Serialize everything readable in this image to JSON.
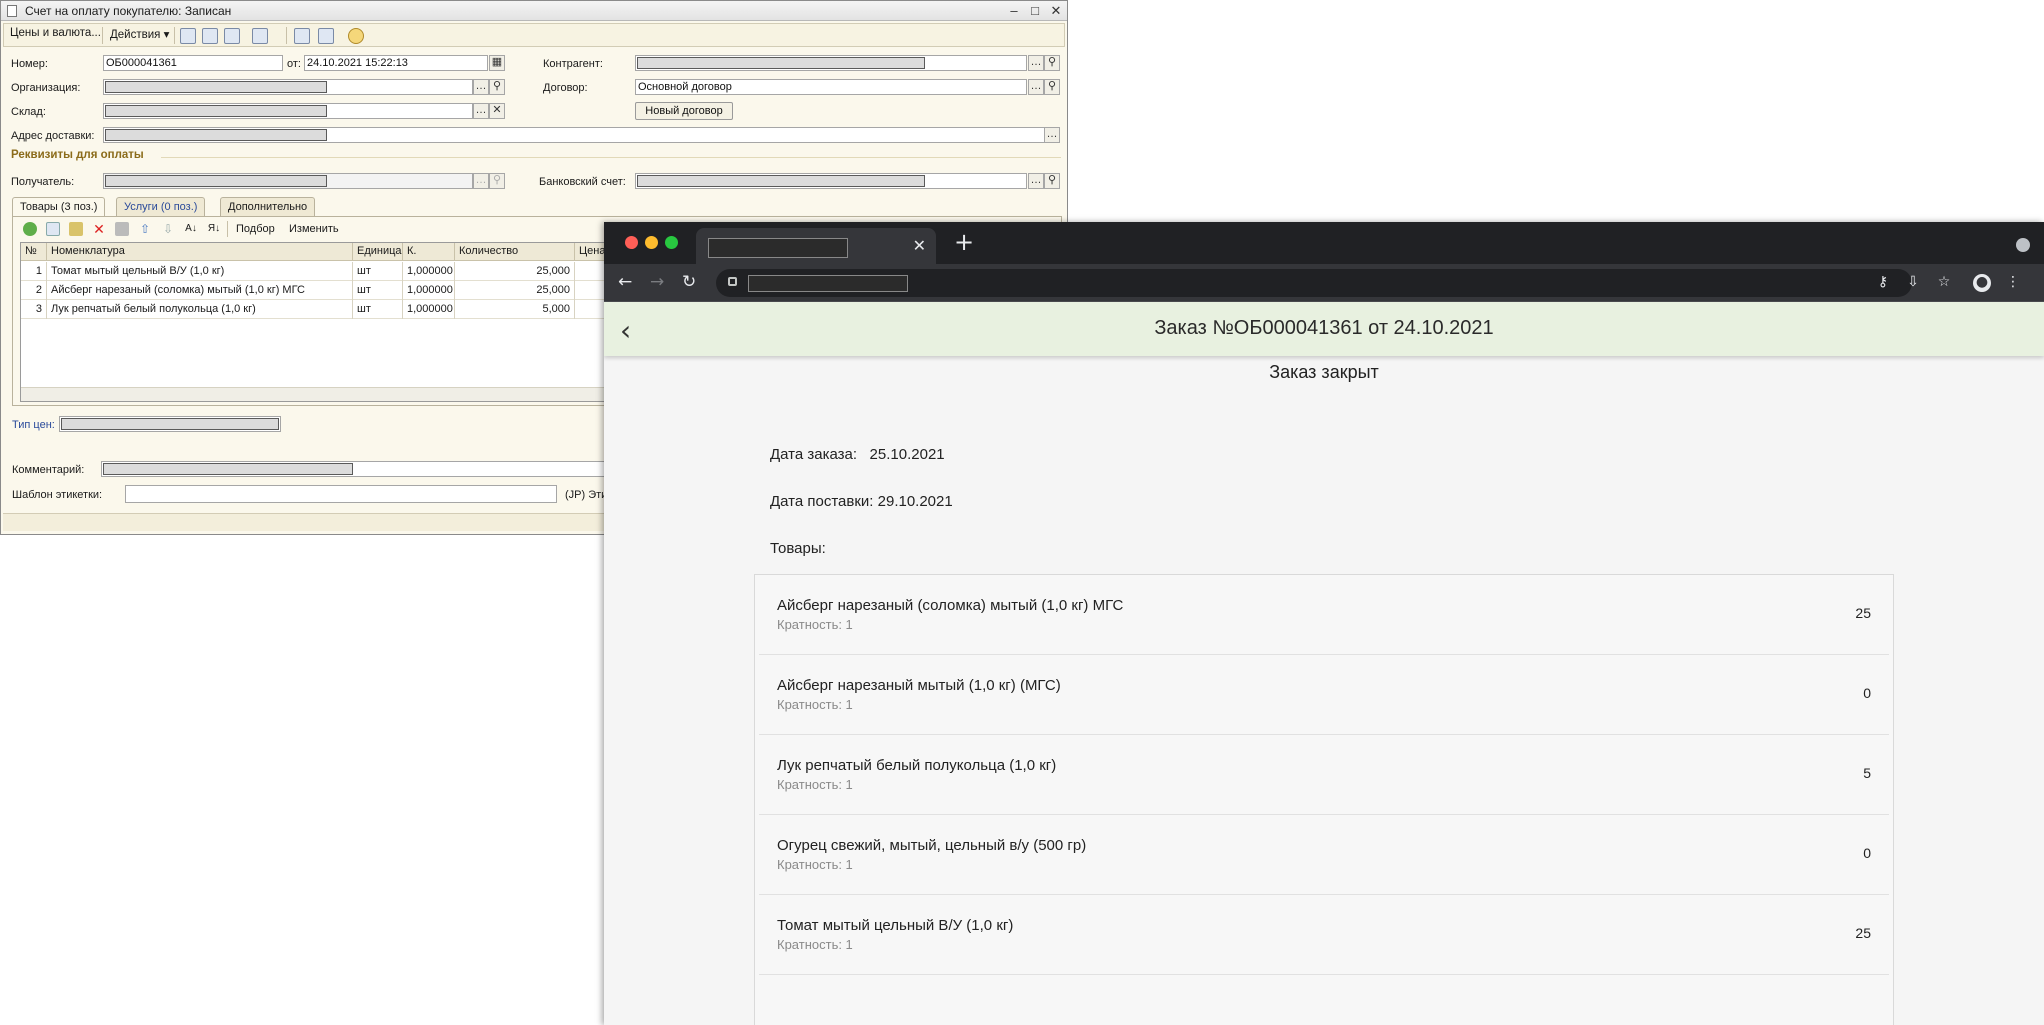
{
  "win1c": {
    "title": "Счет на оплату покупателю: Записан",
    "toolbar": {
      "prices": "Цены и валюта...",
      "actions": "Действия"
    },
    "fields": {
      "number_label": "Номер:",
      "number_value": "ОБ000041361",
      "date_label": "от:",
      "date_value": "24.10.2021 15:22:13",
      "org_label": "Организация:",
      "warehouse_label": "Склад:",
      "address_label": "Адрес доставки:",
      "counterparty_label": "Контрагент:",
      "contract_label": "Договор:",
      "contract_value": "Основной договор",
      "new_contract_btn": "Новый договор"
    },
    "payment": {
      "section": "Реквизиты для оплаты",
      "recipient_label": "Получатель:",
      "bank_label": "Банковский счет:"
    },
    "tabs": [
      "Товары (3 поз.)",
      "Услуги (0 поз.)",
      "Дополнительно"
    ],
    "grid_toolbar": {
      "pick": "Подбор",
      "change": "Изменить"
    },
    "grid": {
      "headers": [
        "№",
        "Номенклатура",
        "Единица",
        "К.",
        "Количество",
        "Цена"
      ],
      "rows": [
        [
          "1",
          "Томат мытый цельный В/У (1,0 кг)",
          "шт",
          "1,000000",
          "25,000"
        ],
        [
          "2",
          "Айсберг нарезаный (соломка) мытый (1,0 кг) МГС",
          "шт",
          "1,000000",
          "25,000"
        ],
        [
          "3",
          "Лук репчатый белый полукольца  (1,0 кг)",
          "шт",
          "1,000000",
          "5,000"
        ]
      ]
    },
    "bottom": {
      "price_type_label": "Тип цен:",
      "comment_label": "Комментарий:",
      "label_template": "Шаблон этикетки:",
      "jp_label": "(JP) Эти"
    }
  },
  "browser": {
    "app_title": "Заказ №ОБ000041361 от 24.10.2021",
    "status": "Заказ закрыт",
    "order_date": "Дата заказа:   25.10.2021",
    "delivery_date": "Дата поставки: 29.10.2021",
    "goods_label": "Товары:",
    "items": [
      {
        "name": "Айсберг нарезаный (соломка) мытый (1,0 кг) МГС",
        "sub": "Кратность: 1",
        "qty": "25"
      },
      {
        "name": "Айсберг нарезаный мытый (1,0 кг) (МГС)",
        "sub": "Кратность: 1",
        "qty": "0"
      },
      {
        "name": "Лук репчатый белый полукольца  (1,0 кг)",
        "sub": "Кратность: 1",
        "qty": "5"
      },
      {
        "name": "Огурец свежий, мытый, цельный в/у (500 гр)",
        "sub": "Кратность: 1",
        "qty": "0"
      },
      {
        "name": "Томат мытый цельный В/У (1,0 кг)",
        "sub": "Кратность: 1",
        "qty": "25"
      }
    ]
  },
  "icons": {
    "close": "close-icon",
    "back": "arrow-left-icon",
    "search": "search-icon"
  }
}
